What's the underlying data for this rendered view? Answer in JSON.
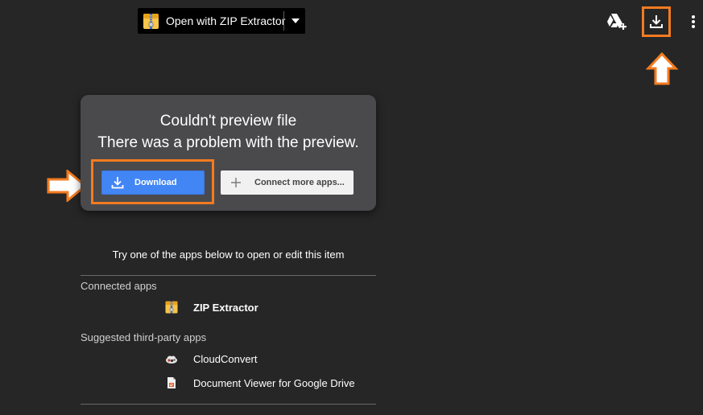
{
  "toolbar": {
    "open_with_label": "Open with ZIP Extractor",
    "icons": {
      "open_with_app": "zip-archive-icon",
      "dropdown": "caret-down-icon",
      "add_to_drive": "drive-add-icon",
      "download": "download-icon",
      "more": "more-vert-icon"
    }
  },
  "preview": {
    "title": "Couldn't preview file",
    "subtitle": "There was a problem with the preview.",
    "download_label": "Download",
    "connect_label": "Connect more apps..."
  },
  "apps": {
    "prompt": "Try one of the apps below to open or edit this item",
    "connected_label": "Connected apps",
    "connected": [
      {
        "name": "ZIP Extractor",
        "icon": "zip-archive-icon"
      }
    ],
    "suggested_label": "Suggested third-party apps",
    "suggested": [
      {
        "name": "CloudConvert",
        "icon": "cloudconvert-icon"
      },
      {
        "name": "Document Viewer for Google Drive",
        "icon": "document-viewer-icon"
      }
    ]
  },
  "colors": {
    "background": "#262626",
    "card": "#4a4a4d",
    "primary_button": "#4285f4",
    "secondary_button": "#f1f1f1",
    "highlight": "#f47b20"
  }
}
